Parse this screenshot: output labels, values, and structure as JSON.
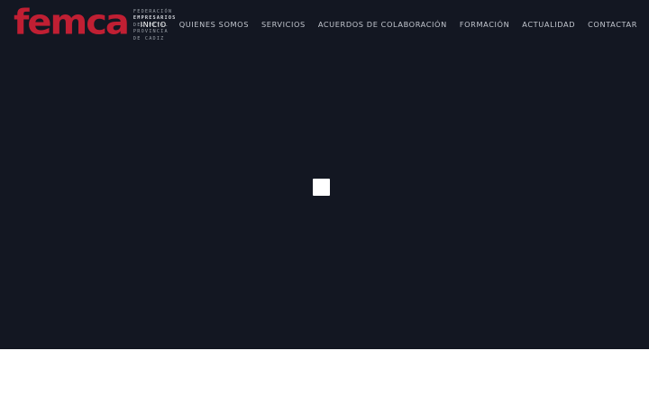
{
  "header": {
    "logo": {
      "word": "femca",
      "tagline": [
        "FEDERACIÓN",
        "EMPRESARIOS",
        "DEL METAL",
        "PROVINCIA",
        "DE CADIZ"
      ],
      "brand_color": "#c01f33"
    },
    "nav": {
      "items": [
        {
          "label": "INICIO",
          "active": true
        },
        {
          "label": "QUIENES SOMOS"
        },
        {
          "label": "SERVICIOS"
        },
        {
          "label": "ACUERDOS DE COLABORACIÓN"
        },
        {
          "label": "FORMACIÓN"
        },
        {
          "label": "ACTUALIDAD"
        },
        {
          "label": "CONTACTAR"
        }
      ]
    }
  },
  "hero": {
    "background": "#131722",
    "loader_icon": "loading-square-icon"
  }
}
